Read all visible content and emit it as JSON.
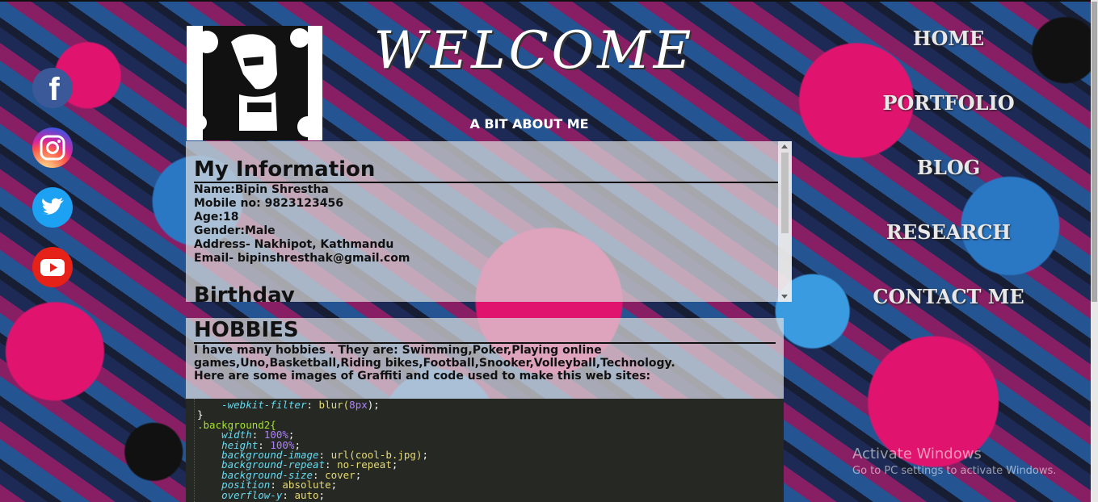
{
  "header": {
    "welcome": "WELCOME",
    "subtitle": "A BIT ABOUT ME"
  },
  "social": [
    {
      "name": "facebook-icon",
      "glyph": "f"
    },
    {
      "name": "instagram-icon",
      "glyph": "◎"
    },
    {
      "name": "twitter-icon",
      "glyph": "🐦"
    },
    {
      "name": "youtube-icon",
      "glyph": "▶"
    }
  ],
  "info": {
    "heading": "My Information",
    "lines": [
      "Name:Bipin Shrestha",
      "Mobile no: 9823123456",
      "Age:18",
      "Gender:Male",
      "Address- Nakhipot, Kathmandu",
      "Email- bipinshresthak@gmail.com"
    ],
    "next_heading": "Birthday"
  },
  "hobbies": {
    "heading": "HOBBIES",
    "text": "I have many hobbies . They are: Swimming,Poker,Playing online games,Uno,Basketball,Riding bikes,Football,Snooker,Volleyball,Technology.",
    "text2": "Here are some images of Graffiti and code used to make this web sites:"
  },
  "nav": {
    "items": [
      "HOME",
      "PORTFOLIO",
      "BLOG",
      "RESEARCH",
      "CONTACT ME"
    ]
  },
  "watermark": {
    "title": "Activate Windows",
    "sub": "Go to PC settings to activate Windows."
  },
  "code_lines": [
    [
      "    ",
      "-webkit-filter",
      ": ",
      "blur(",
      "8px",
      ");"
    ],
    [
      "}",
      "",
      "",
      "",
      "",
      ""
    ],
    [
      ".background2{",
      "",
      "",
      "",
      "",
      ""
    ],
    [
      "    ",
      "width",
      ": ",
      "",
      "100%",
      ";"
    ],
    [
      "    ",
      "height",
      ": ",
      "",
      "100%",
      ";"
    ],
    [
      "    ",
      "background-image",
      ": ",
      "url(cool-b.jpg)",
      "",
      ";"
    ],
    [
      "    ",
      "background-repeat",
      ": ",
      "no-repeat",
      "",
      ";"
    ],
    [
      "    ",
      "background-size",
      ": ",
      "cover",
      "",
      ";"
    ],
    [
      "    ",
      "position",
      ": ",
      "absolute",
      "",
      ";"
    ],
    [
      "    ",
      "overflow-y",
      ": ",
      "auto",
      "",
      ";"
    ]
  ]
}
